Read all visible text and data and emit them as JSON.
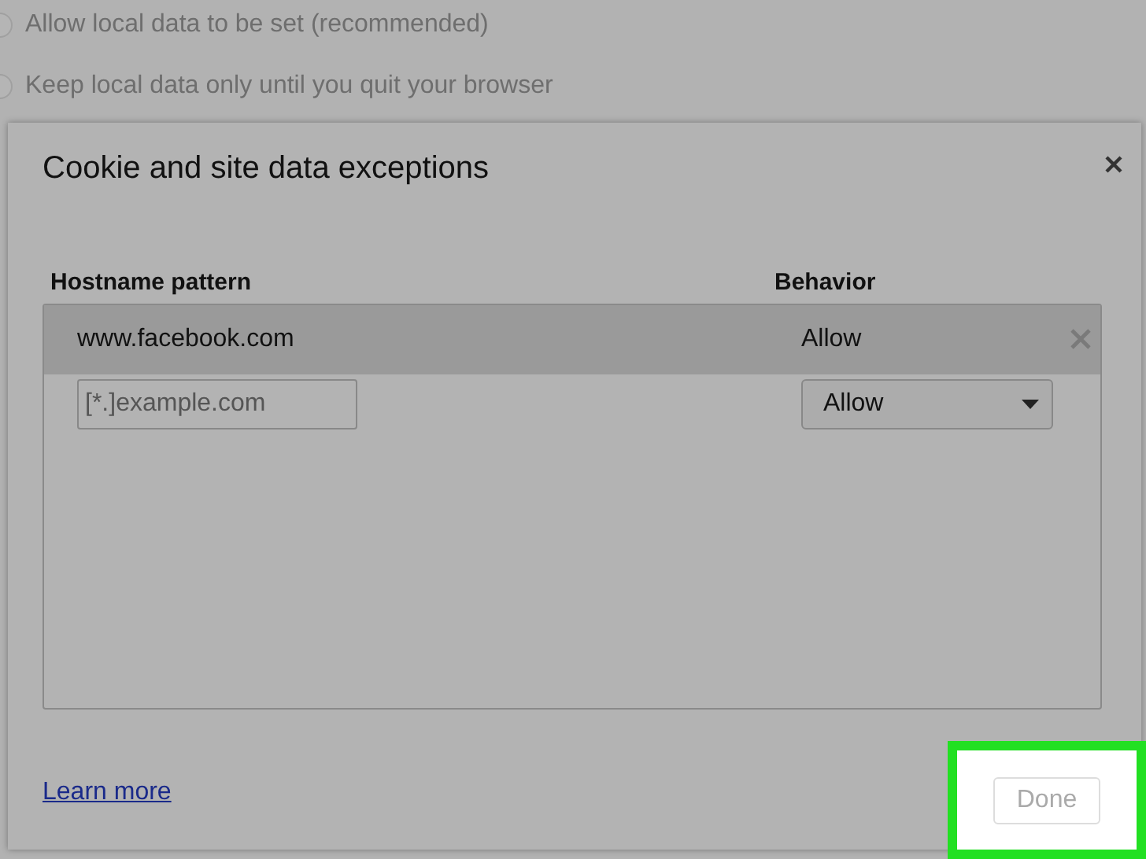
{
  "background_options": [
    {
      "label": "Allow local data to be set (recommended)"
    },
    {
      "label": "Keep local data only until you quit your browser"
    }
  ],
  "dialog": {
    "title": "Cookie and site data exceptions",
    "table": {
      "columns": [
        "Hostname pattern",
        "Behavior"
      ],
      "rows": [
        {
          "hostname": "www.facebook.com",
          "behavior": "Allow",
          "selected": true
        }
      ],
      "new_entry": {
        "placeholder": "[*.]example.com",
        "behavior": "Allow"
      }
    },
    "link": "Learn more",
    "done_button": "Done"
  }
}
